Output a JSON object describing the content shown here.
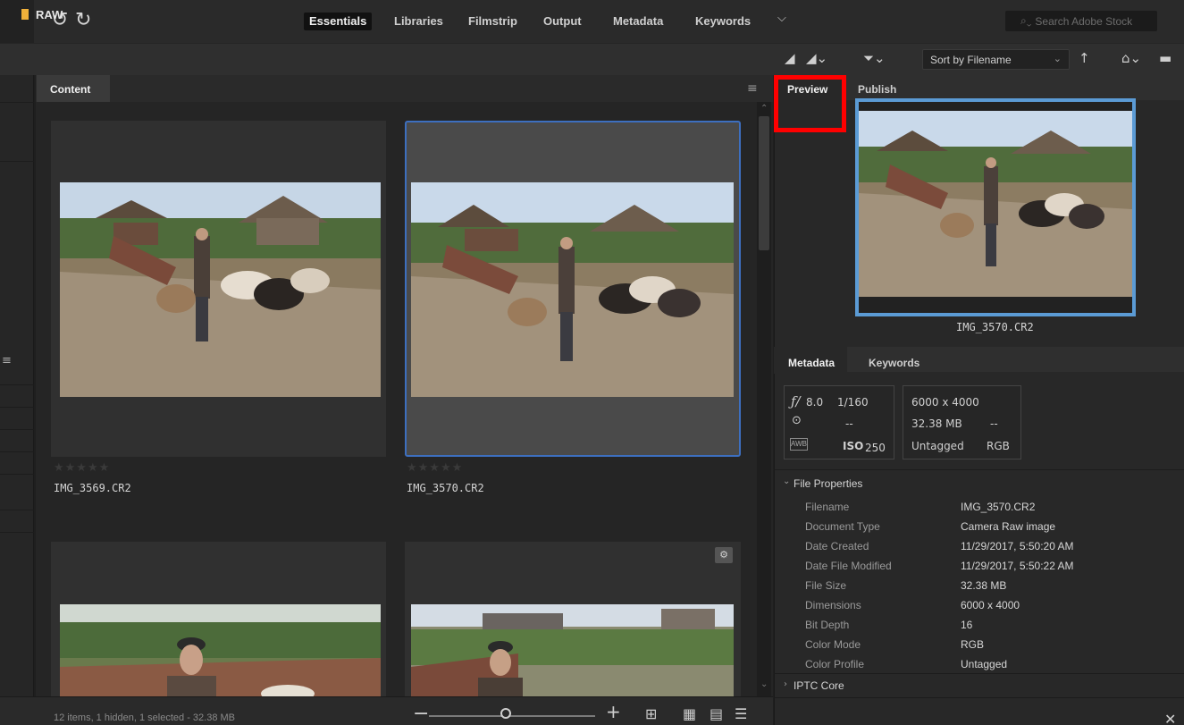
{
  "toolbar": {
    "undo_icon": "rotate-ccw-icon",
    "redo_icon": "rotate-cw-icon",
    "workspaces": [
      "Essentials",
      "Libraries",
      "Filmstrip",
      "Output",
      "Metadata",
      "Keywords"
    ],
    "active_workspace": "Essentials",
    "more_chevron": "⌄",
    "search_placeholder": "Search Adobe Stock"
  },
  "path": {
    "folder_label": "RAW",
    "sort_label": "Sort by Filename"
  },
  "content": {
    "tab_label": "Content",
    "thumbnails": [
      {
        "name": "IMG_3569.CR2",
        "stars": "★★★★★",
        "selected": false
      },
      {
        "name": "IMG_3570.CR2",
        "stars": "★★★★★",
        "selected": true
      },
      {
        "name": "",
        "stars": "",
        "selected": false
      },
      {
        "name": "",
        "stars": "",
        "selected": false
      }
    ],
    "status": "12 items, 1 hidden, 1 selected - 32.38 MB"
  },
  "preview": {
    "tabs": [
      "Preview",
      "Publish"
    ],
    "active_tab": "Preview",
    "filename": "IMG_3570.CR2"
  },
  "metadata": {
    "tabs": [
      "Metadata",
      "Keywords"
    ],
    "aperture": "8.0",
    "shutter": "1/160",
    "metering": "--",
    "iso_label": "ISO",
    "iso_value": "250",
    "awb": "AWB",
    "dimensions": "6000 x 4000",
    "size": "32.38 MB",
    "size_extra": "--",
    "profile": "Untagged",
    "color_mode": "RGB",
    "file_properties_label": "File Properties",
    "file_properties": [
      {
        "key": "Filename",
        "value": "IMG_3570.CR2"
      },
      {
        "key": "Document Type",
        "value": "Camera Raw image"
      },
      {
        "key": "Date Created",
        "value": "11/29/2017, 5:50:20 AM"
      },
      {
        "key": "Date File Modified",
        "value": "11/29/2017, 5:50:22 AM"
      },
      {
        "key": "File Size",
        "value": "32.38 MB"
      },
      {
        "key": "Dimensions",
        "value": "6000 x 4000"
      },
      {
        "key": "Bit Depth",
        "value": "16"
      },
      {
        "key": "Color Mode",
        "value": "RGB"
      },
      {
        "key": "Color Profile",
        "value": "Untagged"
      }
    ],
    "iptc_core_label": "IPTC Core"
  },
  "colors": {
    "selection_blue": "#3d6fbf",
    "preview_border": "#5b9bd5",
    "highlight_red": "#ff0000",
    "folder_yellow": "#f1b13a"
  }
}
